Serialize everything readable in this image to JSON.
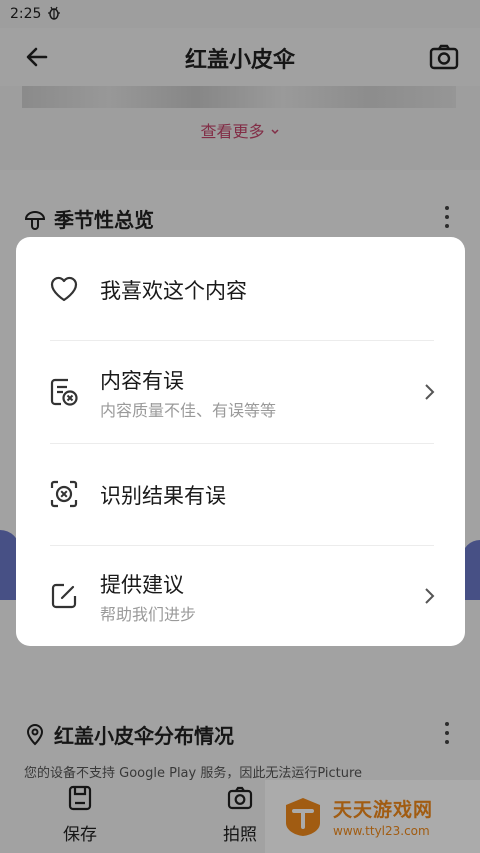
{
  "status_bar": {
    "time": "2:25",
    "notification_icon": "bug-icon"
  },
  "app_bar": {
    "title": "红盖小皮伞",
    "back_icon": "back-arrow-icon",
    "camera_icon": "camera-icon"
  },
  "gallery": {
    "more_link": "查看更多",
    "more_icon": "chevron-down-icon",
    "accent": "#c2456a"
  },
  "section_seasonal": {
    "title": "季节性总览",
    "icon": "mushroom-icon",
    "menu_icon": "more-vertical-icon"
  },
  "section_distribution": {
    "title": "红盖小皮伞分布情况",
    "icon": "location-pin-icon",
    "notice": "您的设备不支持 Google Play 服务，因此无法运行Picture"
  },
  "bottom_nav": [
    {
      "label": "保存",
      "icon": "save-icon"
    },
    {
      "label": "拍照",
      "icon": "camera-icon"
    }
  ],
  "watermark": {
    "brand": "天天游戏网",
    "url": "www.ttyl23.com"
  },
  "feedback_menu": {
    "items": [
      {
        "label": "我喜欢这个内容",
        "sub": "",
        "icon": "heart-icon",
        "has_chevron": false
      },
      {
        "label": "内容有误",
        "sub": "内容质量不佳、有误等等",
        "icon": "report-error-icon",
        "has_chevron": true
      },
      {
        "label": "识别结果有误",
        "sub": "",
        "icon": "scan-error-icon",
        "has_chevron": false
      },
      {
        "label": "提供建议",
        "sub": "帮助我们进步",
        "icon": "edit-suggestion-icon",
        "has_chevron": true
      }
    ]
  }
}
